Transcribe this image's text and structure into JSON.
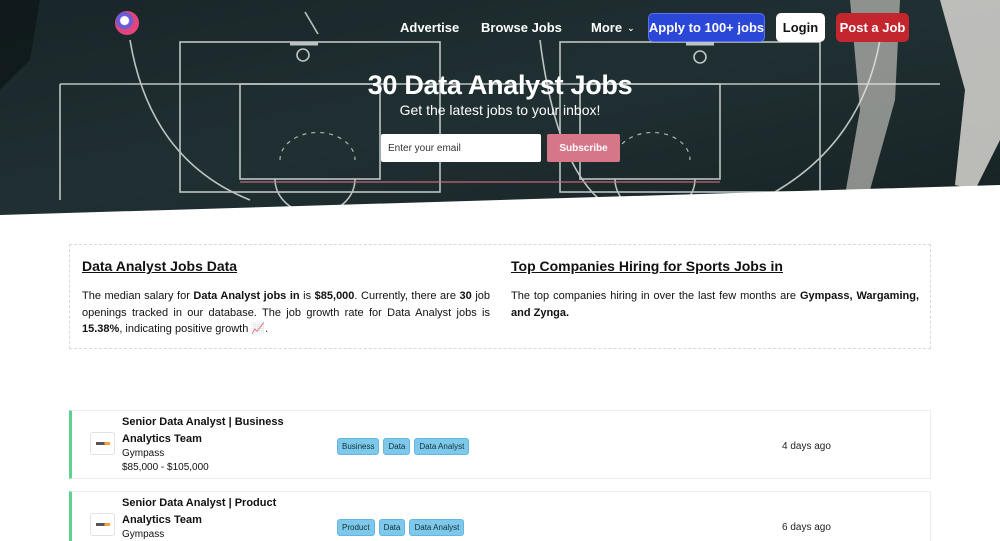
{
  "nav": {
    "links": [
      "Advertise",
      "Browse Jobs",
      "More"
    ],
    "apply_label": "Apply to 100+ jobs",
    "login_label": "Login",
    "post_label": "Post a Job"
  },
  "hero": {
    "title": "30 Data Analyst Jobs",
    "subtitle": "Get the latest jobs to your inbox!",
    "email_placeholder": "Enter your email",
    "subscribe_label": "Subscribe"
  },
  "info": {
    "left_heading": "Data Analyst Jobs Data",
    "left_text": {
      "p1": "The median salary for ",
      "b1": "Data Analyst jobs in",
      "p2": " is ",
      "b2": "$85,000",
      "p3": ". Currently, there are ",
      "b3": "30",
      "p4": " job openings tracked in our database. The job growth rate for Data Analyst jobs is ",
      "b4": "15.38%",
      "p5": ", indicating positive growth 📈."
    },
    "right_heading": "Top Companies Hiring for Sports Jobs in",
    "right_text": {
      "p1": "The top companies hiring in over the last few months are ",
      "b1": "Gympass, Wargaming, and Zynga."
    }
  },
  "jobs": [
    {
      "title": "Senior Data Analyst | Business Analytics Team",
      "company": "Gympass",
      "salary": "$85,000 - $105,000",
      "tags": [
        "Business",
        "Data",
        "Data Analyst"
      ],
      "age": "4 days ago"
    },
    {
      "title": "Senior Data Analyst | Product Analytics Team",
      "company": "Gympass",
      "tags": [
        "Product",
        "Data",
        "Data Analyst"
      ],
      "age": "6 days ago"
    }
  ],
  "colors": {
    "apply": "#2b47d8",
    "post": "#c4262e",
    "subscribe": "#d57689",
    "tag": "#7ec8ec",
    "job_accent": "#5fd18d"
  }
}
